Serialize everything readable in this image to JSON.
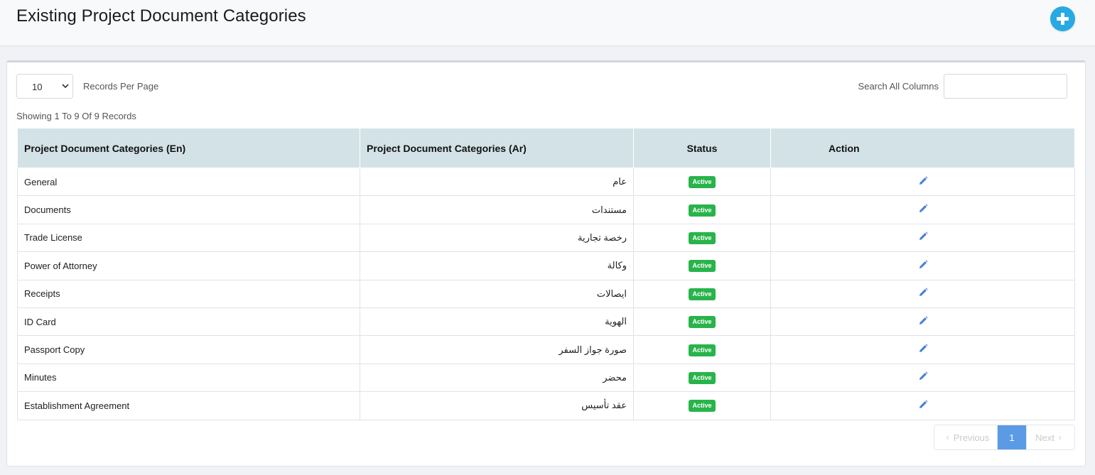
{
  "header": {
    "title": "Existing Project Document Categories",
    "add_icon": "plus-circle-icon",
    "accent": "#27a9e3"
  },
  "controls": {
    "records_per_page_value": "10",
    "records_per_page_label": "Records Per Page",
    "search_label": "Search All Columns",
    "search_value": "",
    "showing_text": "Showing 1 To 9 Of 9 Records"
  },
  "table": {
    "columns": [
      "Project Document Categories (En)",
      "Project Document Categories (Ar)",
      "Status",
      "Action"
    ],
    "rows": [
      {
        "en": "General",
        "ar": "عام",
        "status": "Active"
      },
      {
        "en": "Documents",
        "ar": "مستندات",
        "status": "Active"
      },
      {
        "en": "Trade License",
        "ar": "رخصة تجارية",
        "status": "Active"
      },
      {
        "en": "Power of Attorney",
        "ar": "وكالة",
        "status": "Active"
      },
      {
        "en": "Receipts",
        "ar": "ايصالات",
        "status": "Active"
      },
      {
        "en": "ID Card",
        "ar": "الهوية",
        "status": "Active"
      },
      {
        "en": "Passport Copy",
        "ar": "صورة جواز السفر",
        "status": "Active"
      },
      {
        "en": "Minutes",
        "ar": "محضر",
        "status": "Active"
      },
      {
        "en": "Establishment Agreement",
        "ar": "عقد تأسيس",
        "status": "Active"
      }
    ],
    "action_icon": "pencil-icon",
    "status_color": "#28b44a",
    "header_bg": "#d3e2e6"
  },
  "pagination": {
    "previous_label": "Previous",
    "current_page": "1",
    "next_label": "Next",
    "active_color": "#5b9be6"
  }
}
